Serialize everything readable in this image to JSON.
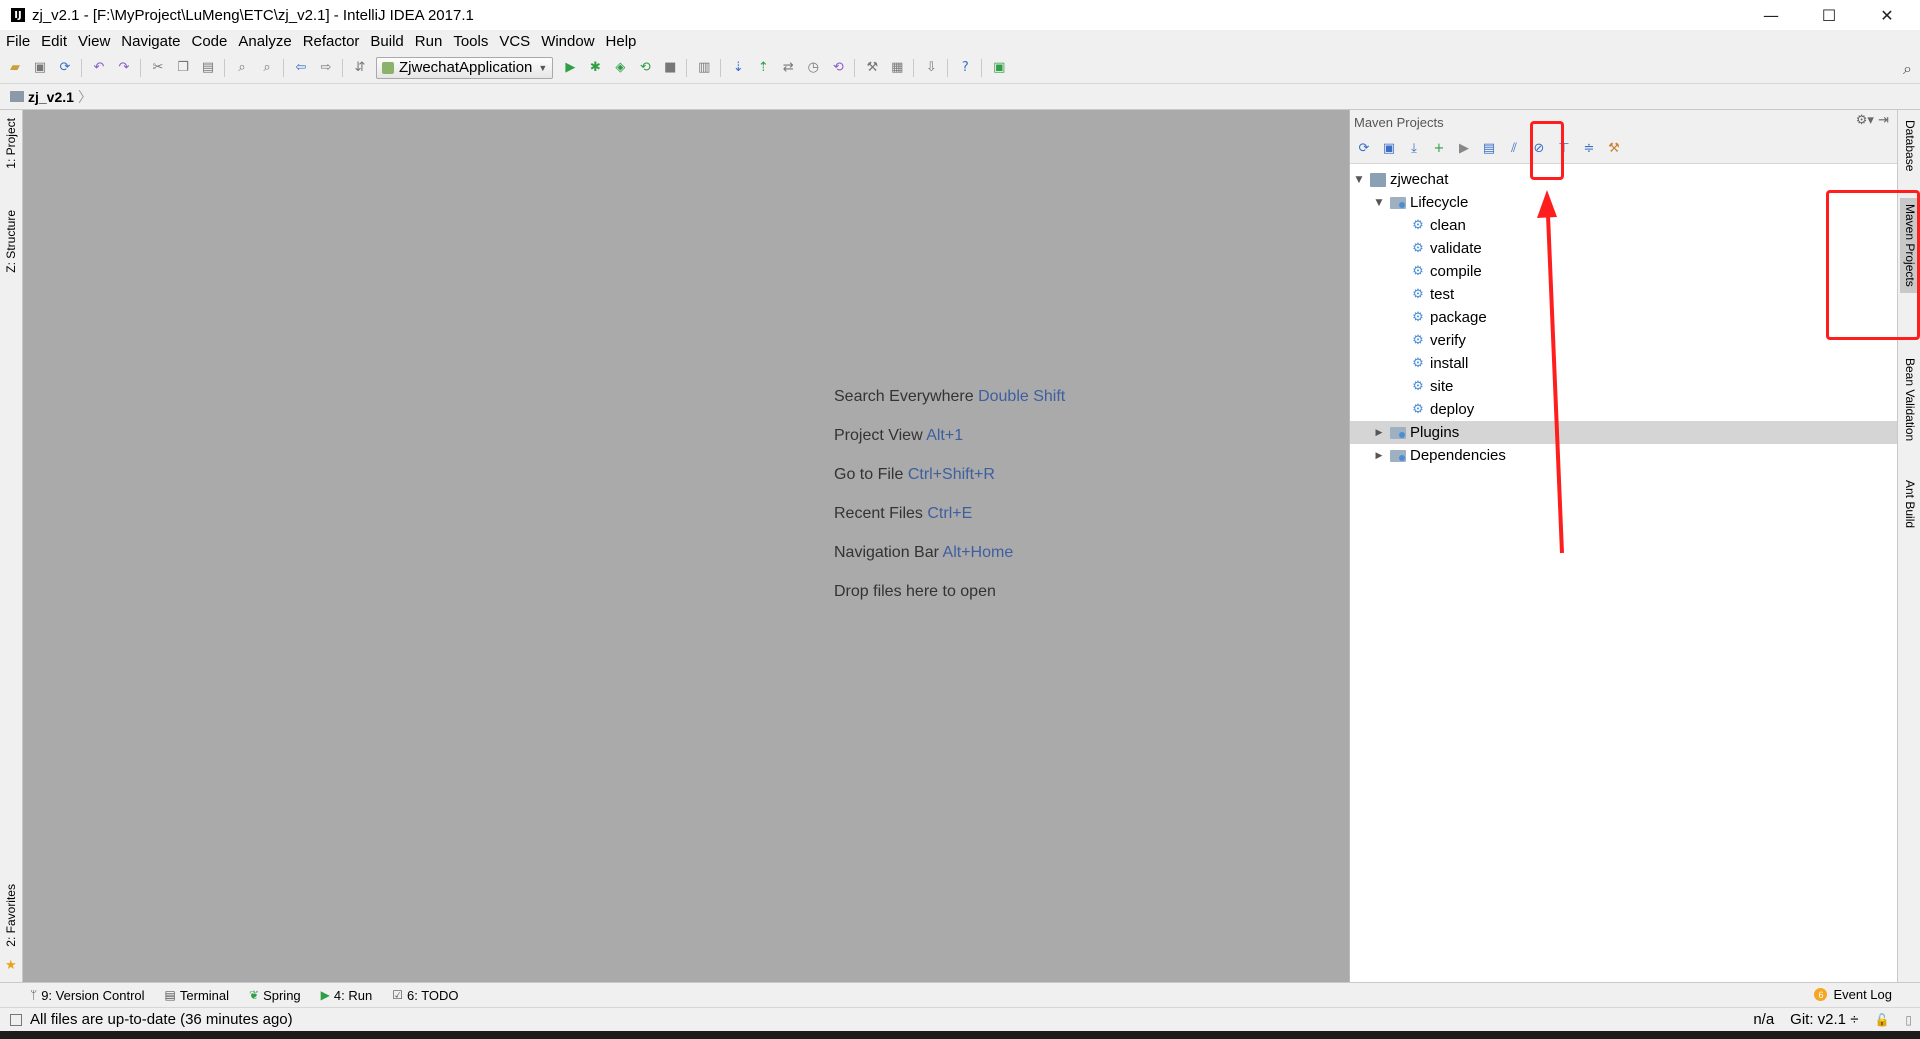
{
  "window": {
    "title": "zj_v2.1 - [F:\\MyProject\\LuMeng\\ETC\\zj_v2.1] - IntelliJ IDEA 2017.1",
    "controls": [
      "—",
      "☐",
      "✕"
    ]
  },
  "menu": [
    "File",
    "Edit",
    "View",
    "Navigate",
    "Code",
    "Analyze",
    "Refactor",
    "Build",
    "Run",
    "Tools",
    "VCS",
    "Window",
    "Help"
  ],
  "toolbar": {
    "run_config": "ZjwechatApplication"
  },
  "navbar": {
    "crumb": "zj_v2.1"
  },
  "left_tabs": {
    "project": "1: Project",
    "structure": "Z: Structure",
    "favorites": "2: Favorites"
  },
  "editor_hints": [
    {
      "text": "Search Everywhere",
      "key": "Double Shift"
    },
    {
      "text": "Project View",
      "key": "Alt+1"
    },
    {
      "text": "Go to File",
      "key": "Ctrl+Shift+R"
    },
    {
      "text": "Recent Files",
      "key": "Ctrl+E"
    },
    {
      "text": "Navigation Bar",
      "key": "Alt+Home"
    },
    {
      "text": "Drop files here to open",
      "key": ""
    }
  ],
  "maven": {
    "title": "Maven Projects",
    "project": "zjwechat",
    "lifecycle_label": "Lifecycle",
    "lifecycle": [
      "clean",
      "validate",
      "compile",
      "test",
      "package",
      "verify",
      "install",
      "site",
      "deploy"
    ],
    "plugins_label": "Plugins",
    "dependencies_label": "Dependencies"
  },
  "right_tabs": {
    "database": "Database",
    "maven": "Maven Projects",
    "bean": "Bean Validation",
    "ant": "Ant Build"
  },
  "bottom_tabs": [
    {
      "icon": "version-control-icon",
      "label": "9: Version Control"
    },
    {
      "icon": "terminal-icon",
      "label": "Terminal"
    },
    {
      "icon": "spring-icon",
      "label": "Spring"
    },
    {
      "icon": "run-icon",
      "label": "4: Run"
    },
    {
      "icon": "todo-icon",
      "label": "6: TODO"
    }
  ],
  "event_log": {
    "count": "6",
    "label": "Event Log"
  },
  "status": {
    "message": "All files are up-to-date (36 minutes ago)",
    "position": "n/a",
    "git": "Git: v2.1 ÷"
  },
  "annotation_color": "#ff1e1e"
}
